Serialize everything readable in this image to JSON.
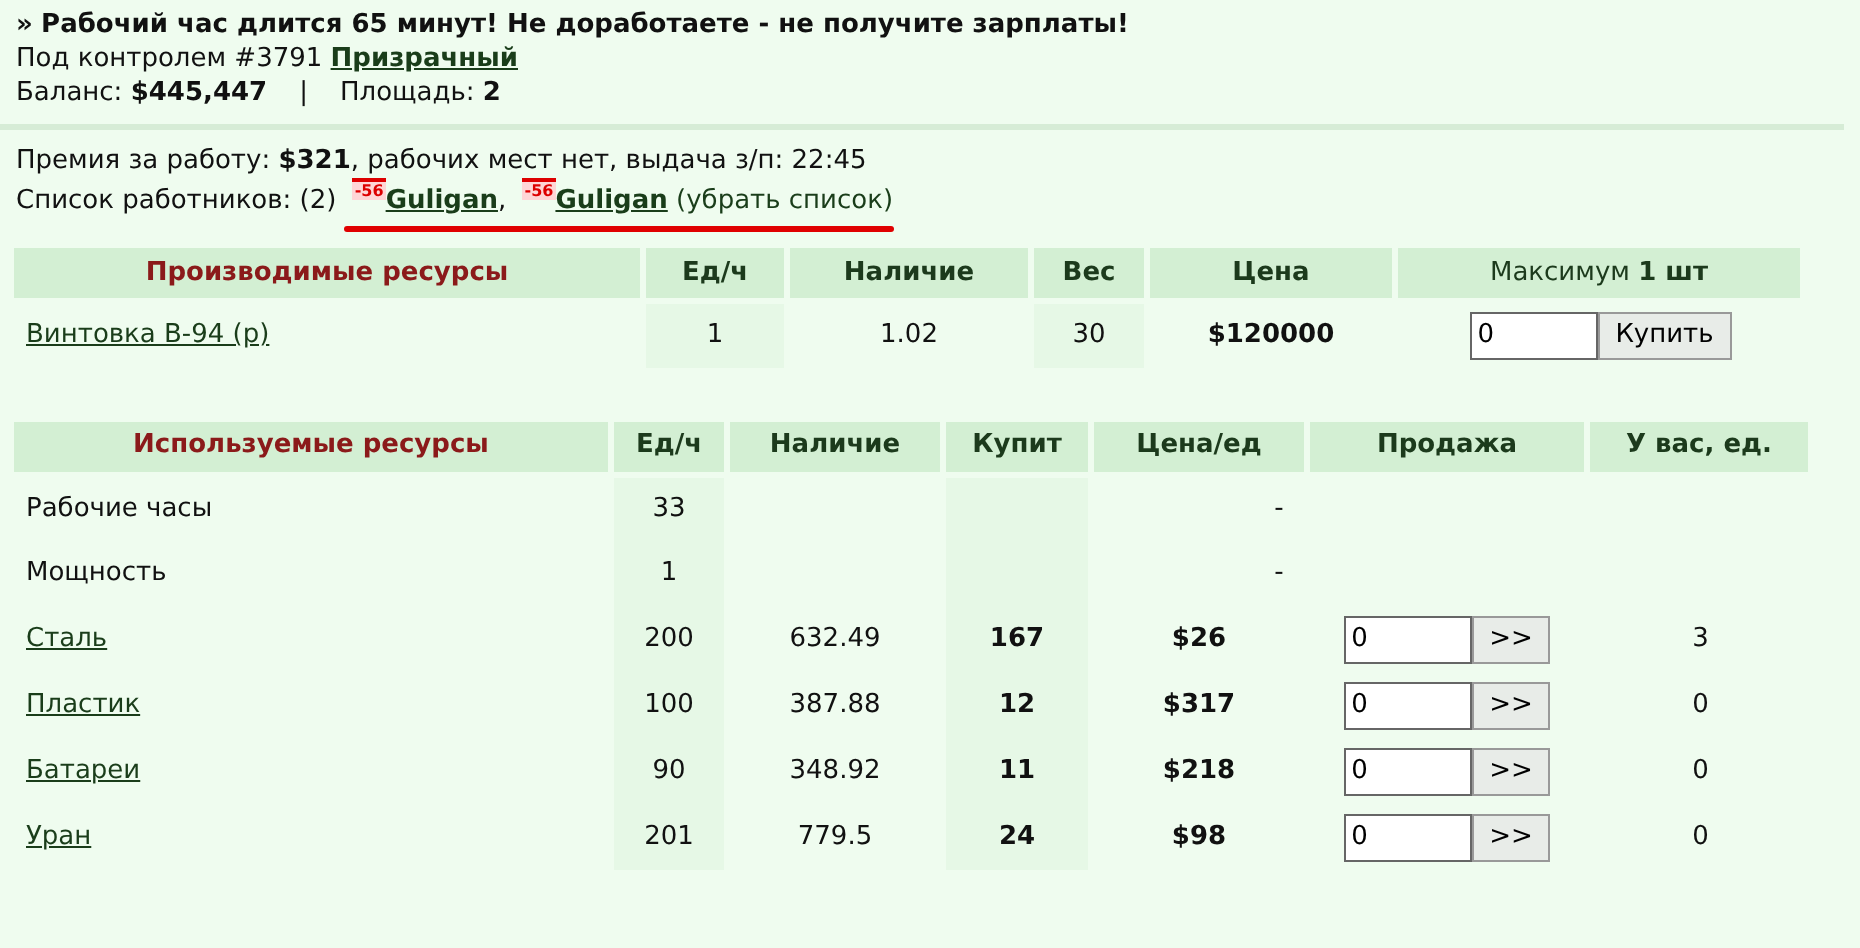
{
  "headline": {
    "prefix": "»",
    "text": "Рабочий час длится 65 минут! Не доработаете - не получите зарплаты!"
  },
  "control": {
    "label": "Под контролем #3791",
    "owner": "Призрачный"
  },
  "balance": {
    "label": "Баланс:",
    "value": "$445,447",
    "separator": "|",
    "area_label": "Площадь:",
    "area_value": "2"
  },
  "bonus": "Премия за работу: **$321**, рабочих мест нет, выдача з/п: 22:45",
  "workers": {
    "label": "Список работников: (2)",
    "items": [
      {
        "badge": "-56",
        "name": "Guligan",
        "separator": ","
      },
      {
        "badge": "-56",
        "name": "Guligan"
      }
    ],
    "remove_link": "(убрать список)",
    "annotation": {
      "kind": "underline",
      "color": "#e00000"
    }
  },
  "produced": {
    "columns": [
      "Производимые ресурсы",
      "Ед/ч",
      "Наличие",
      "Вес",
      "Цена",
      "Максимум **1 шт**"
    ],
    "rows": [
      {
        "name": "Винтовка В-94 (р)",
        "per_hour": "1",
        "stock": "1.02",
        "weight": "30",
        "price": "$120000",
        "quantity": "0",
        "button": "Купить"
      }
    ]
  },
  "used": {
    "columns": [
      "Используемые ресурсы",
      "Ед/ч",
      "Наличие",
      "Купит",
      "Цена/ед",
      "Продажа",
      "У вас, ед."
    ],
    "rows": [
      {
        "kind": "plain",
        "name": "Рабочие часы",
        "per_hour": "33",
        "price": "-"
      },
      {
        "kind": "plain",
        "name": "Мощность",
        "per_hour": "1",
        "price": "-"
      },
      {
        "kind": "trade",
        "name": "Сталь",
        "per_hour": "200",
        "stock": "632.49",
        "buys": "167",
        "price": "$26",
        "quantity": "0",
        "button": ">>",
        "owned": "3"
      },
      {
        "kind": "trade",
        "name": "Пластик",
        "per_hour": "100",
        "stock": "387.88",
        "buys": "12",
        "price": "$317",
        "quantity": "0",
        "button": ">>",
        "owned": "0"
      },
      {
        "kind": "trade",
        "name": "Батареи",
        "per_hour": "90",
        "stock": "348.92",
        "buys": "11",
        "price": "$218",
        "quantity": "0",
        "button": ">>",
        "owned": "0"
      },
      {
        "kind": "trade",
        "name": "Уран",
        "per_hour": "201",
        "stock": "779.5",
        "buys": "24",
        "price": "$98",
        "quantity": "0",
        "button": ">>",
        "owned": "0"
      }
    ]
  }
}
